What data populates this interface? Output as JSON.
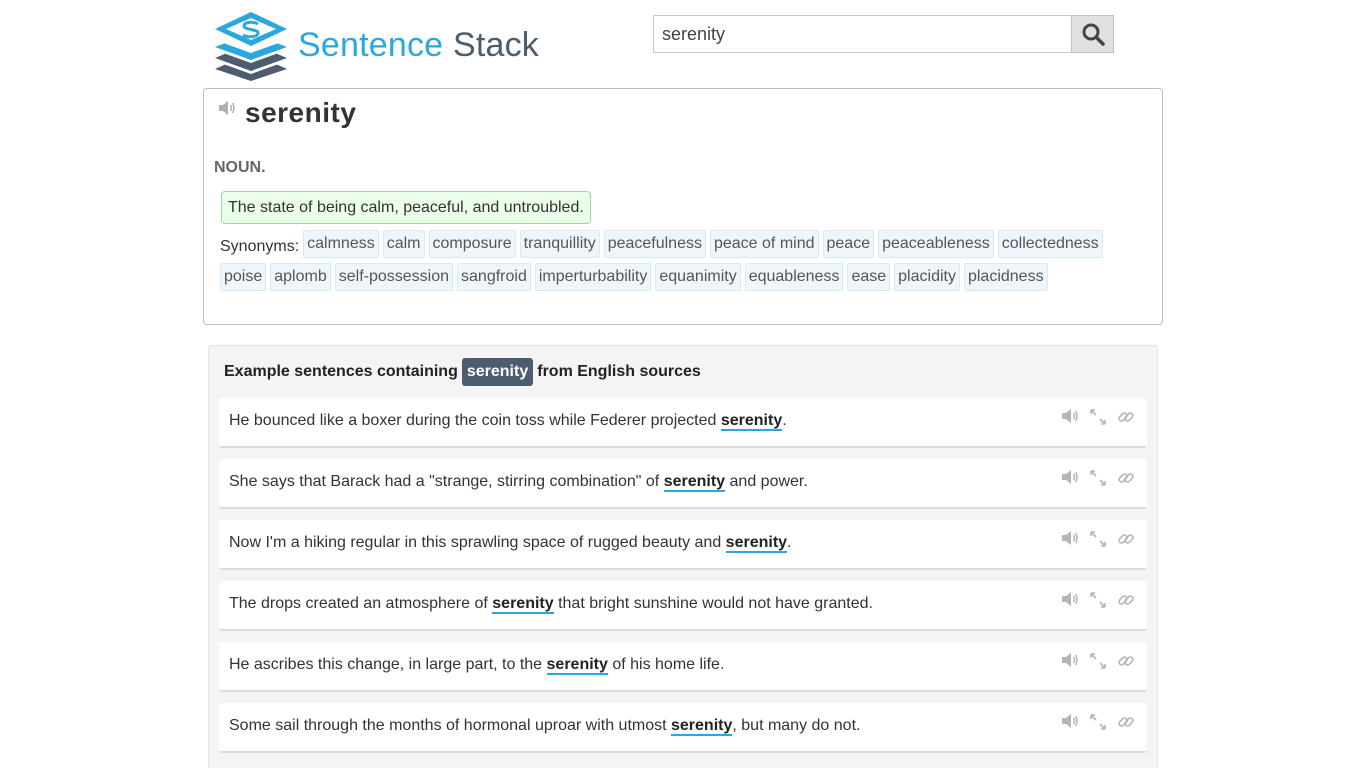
{
  "brand": {
    "part1": "Sentence",
    "part2": "Stack"
  },
  "search": {
    "value": "serenity"
  },
  "entry": {
    "word": "serenity",
    "pos": "NOUN.",
    "definition": "The state of being calm, peaceful, and untroubled.",
    "synonyms_label": "Synonyms:",
    "synonyms": [
      "calmness",
      "calm",
      "composure",
      "tranquillity",
      "peacefulness",
      "peace of mind",
      "peace",
      "peaceableness",
      "collectedness",
      "poise",
      "aplomb",
      "self-possession",
      "sangfroid",
      "imperturbability",
      "equanimity",
      "equableness",
      "ease",
      "placidity",
      "placidness"
    ]
  },
  "examples": {
    "head_before": "Example sentences containing",
    "head_word": "serenity",
    "head_after": "from English sources",
    "items": [
      {
        "before": "He bounced like a boxer during the coin toss while Federer projected ",
        "word": "serenity",
        "after": "."
      },
      {
        "before": "She says that Barack had a \"strange, stirring combination\" of ",
        "word": "serenity",
        "after": " and power."
      },
      {
        "before": "Now I'm a hiking regular in this sprawling space of rugged beauty and ",
        "word": "serenity",
        "after": "."
      },
      {
        "before": "The drops created an atmosphere of ",
        "word": "serenity",
        "after": " that bright sunshine would not have granted."
      },
      {
        "before": "He ascribes this change, in large part, to the ",
        "word": "serenity",
        "after": " of his home life."
      },
      {
        "before": "Some sail through the months of hormonal uproar with utmost ",
        "word": "serenity",
        "after": ", but many do not."
      }
    ]
  }
}
